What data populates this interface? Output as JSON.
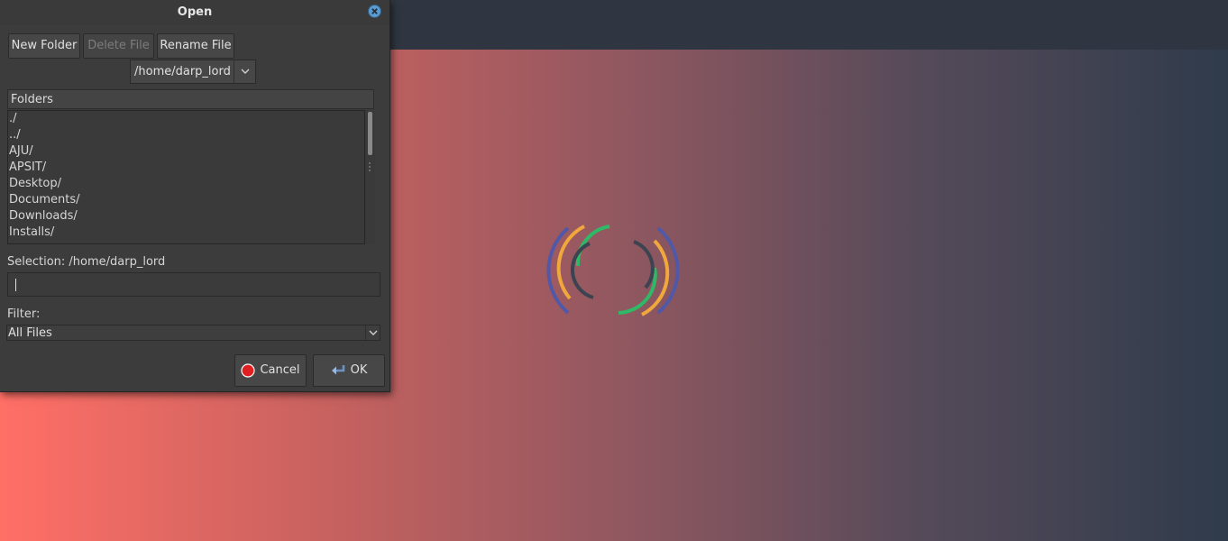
{
  "dialog": {
    "title": "Open",
    "toolbar": {
      "new_folder": "New Folder",
      "delete_file": "Delete File",
      "rename_file": "Rename File"
    },
    "path": "/home/darp_lord",
    "folders_header": "Folders",
    "folders": [
      "./",
      "../",
      "AJU/",
      "APSIT/",
      "Desktop/",
      "Documents/",
      "Downloads/",
      "Installs/"
    ],
    "selection_label": "Selection: /home/darp_lord",
    "selection_value": "",
    "filter_label": "Filter:",
    "filter_value": "All Files",
    "cancel": "Cancel",
    "ok": "OK"
  },
  "colors": {
    "close_button": "#5b9bd0",
    "cancel_icon": "#e02020",
    "ok_icon": "#6b93c4",
    "loader_blue": "#5158a8",
    "loader_orange": "#f0a83c",
    "loader_green": "#2fb866",
    "loader_dark": "#3b4450"
  }
}
